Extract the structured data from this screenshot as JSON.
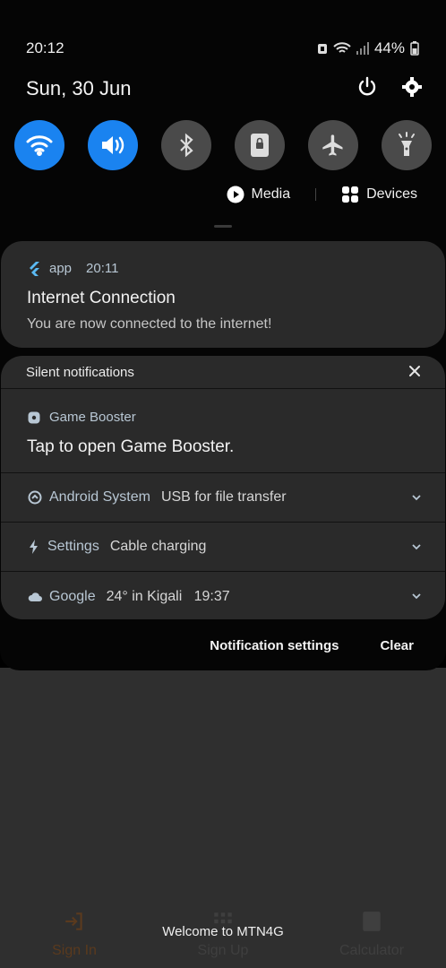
{
  "status": {
    "time": "20:12",
    "battery": "44%"
  },
  "header": {
    "date": "Sun, 30 Jun"
  },
  "quick_settings": [
    {
      "name": "wifi",
      "on": true
    },
    {
      "name": "sound",
      "on": true
    },
    {
      "name": "bluetooth",
      "on": false
    },
    {
      "name": "auto-rotate",
      "on": false
    },
    {
      "name": "airplane-mode",
      "on": false
    },
    {
      "name": "flashlight",
      "on": false
    }
  ],
  "media_bar": {
    "media_label": "Media",
    "devices_label": "Devices"
  },
  "notification": {
    "app": "app",
    "time": "20:11",
    "title": "Internet Connection",
    "body": "You are now connected to the internet!"
  },
  "silent": {
    "header": "Silent notifications",
    "game_booster": {
      "app": "Game Booster",
      "text": "Tap to open Game Booster."
    },
    "rows": [
      {
        "app": "Android System",
        "msg": "USB for file transfer"
      },
      {
        "app": "Settings",
        "msg": "Cable charging"
      },
      {
        "app": "Google",
        "msg": "24° in Kigali   19:37"
      }
    ]
  },
  "footer": {
    "settings": "Notification settings",
    "clear": "Clear"
  },
  "app_behind": {
    "nav": [
      {
        "label": "Sign In"
      },
      {
        "label": "Sign Up"
      },
      {
        "label": "Calculator"
      }
    ],
    "toast": "Welcome to MTN4G"
  },
  "colors": {
    "accent": "#1a83f0",
    "card": "#2a2a2a",
    "app_label": "#b8c7d4"
  }
}
